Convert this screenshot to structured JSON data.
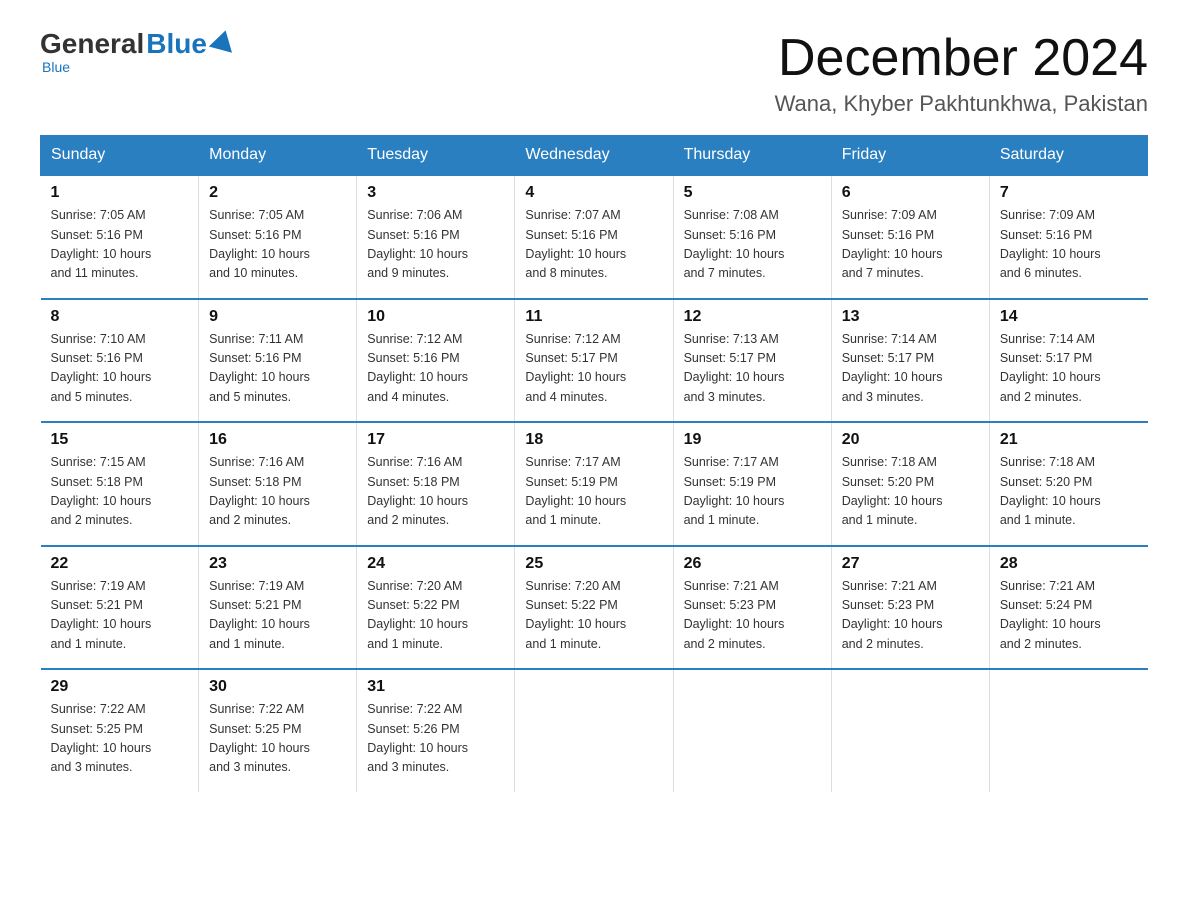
{
  "header": {
    "logo_general": "General",
    "logo_blue": "Blue",
    "month_title": "December 2024",
    "location": "Wana, Khyber Pakhtunkhwa, Pakistan"
  },
  "days_of_week": [
    "Sunday",
    "Monday",
    "Tuesday",
    "Wednesday",
    "Thursday",
    "Friday",
    "Saturday"
  ],
  "weeks": [
    [
      {
        "day": "1",
        "info": "Sunrise: 7:05 AM\nSunset: 5:16 PM\nDaylight: 10 hours\nand 11 minutes."
      },
      {
        "day": "2",
        "info": "Sunrise: 7:05 AM\nSunset: 5:16 PM\nDaylight: 10 hours\nand 10 minutes."
      },
      {
        "day": "3",
        "info": "Sunrise: 7:06 AM\nSunset: 5:16 PM\nDaylight: 10 hours\nand 9 minutes."
      },
      {
        "day": "4",
        "info": "Sunrise: 7:07 AM\nSunset: 5:16 PM\nDaylight: 10 hours\nand 8 minutes."
      },
      {
        "day": "5",
        "info": "Sunrise: 7:08 AM\nSunset: 5:16 PM\nDaylight: 10 hours\nand 7 minutes."
      },
      {
        "day": "6",
        "info": "Sunrise: 7:09 AM\nSunset: 5:16 PM\nDaylight: 10 hours\nand 7 minutes."
      },
      {
        "day": "7",
        "info": "Sunrise: 7:09 AM\nSunset: 5:16 PM\nDaylight: 10 hours\nand 6 minutes."
      }
    ],
    [
      {
        "day": "8",
        "info": "Sunrise: 7:10 AM\nSunset: 5:16 PM\nDaylight: 10 hours\nand 5 minutes."
      },
      {
        "day": "9",
        "info": "Sunrise: 7:11 AM\nSunset: 5:16 PM\nDaylight: 10 hours\nand 5 minutes."
      },
      {
        "day": "10",
        "info": "Sunrise: 7:12 AM\nSunset: 5:16 PM\nDaylight: 10 hours\nand 4 minutes."
      },
      {
        "day": "11",
        "info": "Sunrise: 7:12 AM\nSunset: 5:17 PM\nDaylight: 10 hours\nand 4 minutes."
      },
      {
        "day": "12",
        "info": "Sunrise: 7:13 AM\nSunset: 5:17 PM\nDaylight: 10 hours\nand 3 minutes."
      },
      {
        "day": "13",
        "info": "Sunrise: 7:14 AM\nSunset: 5:17 PM\nDaylight: 10 hours\nand 3 minutes."
      },
      {
        "day": "14",
        "info": "Sunrise: 7:14 AM\nSunset: 5:17 PM\nDaylight: 10 hours\nand 2 minutes."
      }
    ],
    [
      {
        "day": "15",
        "info": "Sunrise: 7:15 AM\nSunset: 5:18 PM\nDaylight: 10 hours\nand 2 minutes."
      },
      {
        "day": "16",
        "info": "Sunrise: 7:16 AM\nSunset: 5:18 PM\nDaylight: 10 hours\nand 2 minutes."
      },
      {
        "day": "17",
        "info": "Sunrise: 7:16 AM\nSunset: 5:18 PM\nDaylight: 10 hours\nand 2 minutes."
      },
      {
        "day": "18",
        "info": "Sunrise: 7:17 AM\nSunset: 5:19 PM\nDaylight: 10 hours\nand 1 minute."
      },
      {
        "day": "19",
        "info": "Sunrise: 7:17 AM\nSunset: 5:19 PM\nDaylight: 10 hours\nand 1 minute."
      },
      {
        "day": "20",
        "info": "Sunrise: 7:18 AM\nSunset: 5:20 PM\nDaylight: 10 hours\nand 1 minute."
      },
      {
        "day": "21",
        "info": "Sunrise: 7:18 AM\nSunset: 5:20 PM\nDaylight: 10 hours\nand 1 minute."
      }
    ],
    [
      {
        "day": "22",
        "info": "Sunrise: 7:19 AM\nSunset: 5:21 PM\nDaylight: 10 hours\nand 1 minute."
      },
      {
        "day": "23",
        "info": "Sunrise: 7:19 AM\nSunset: 5:21 PM\nDaylight: 10 hours\nand 1 minute."
      },
      {
        "day": "24",
        "info": "Sunrise: 7:20 AM\nSunset: 5:22 PM\nDaylight: 10 hours\nand 1 minute."
      },
      {
        "day": "25",
        "info": "Sunrise: 7:20 AM\nSunset: 5:22 PM\nDaylight: 10 hours\nand 1 minute."
      },
      {
        "day": "26",
        "info": "Sunrise: 7:21 AM\nSunset: 5:23 PM\nDaylight: 10 hours\nand 2 minutes."
      },
      {
        "day": "27",
        "info": "Sunrise: 7:21 AM\nSunset: 5:23 PM\nDaylight: 10 hours\nand 2 minutes."
      },
      {
        "day": "28",
        "info": "Sunrise: 7:21 AM\nSunset: 5:24 PM\nDaylight: 10 hours\nand 2 minutes."
      }
    ],
    [
      {
        "day": "29",
        "info": "Sunrise: 7:22 AM\nSunset: 5:25 PM\nDaylight: 10 hours\nand 3 minutes."
      },
      {
        "day": "30",
        "info": "Sunrise: 7:22 AM\nSunset: 5:25 PM\nDaylight: 10 hours\nand 3 minutes."
      },
      {
        "day": "31",
        "info": "Sunrise: 7:22 AM\nSunset: 5:26 PM\nDaylight: 10 hours\nand 3 minutes."
      },
      {
        "day": "",
        "info": ""
      },
      {
        "day": "",
        "info": ""
      },
      {
        "day": "",
        "info": ""
      },
      {
        "day": "",
        "info": ""
      }
    ]
  ]
}
